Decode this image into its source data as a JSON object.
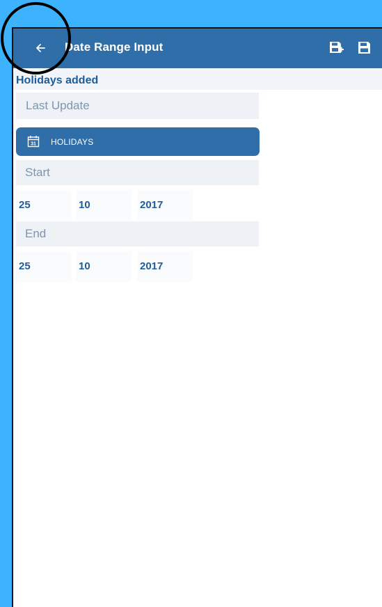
{
  "appbar": {
    "title": "Date Range Input",
    "back_icon": "arrow-left-icon",
    "action_icons": [
      "save-add-icon",
      "save-icon"
    ]
  },
  "status": {
    "text": "Holidays added"
  },
  "last_update": {
    "placeholder": "Last Update",
    "value": ""
  },
  "holidays_button": {
    "label": "HOLIDAYS",
    "icon": "calendar-31-icon"
  },
  "start": {
    "label": "Start",
    "day": "25",
    "month": "10",
    "year": "2017"
  },
  "end": {
    "label": "End",
    "day": "25",
    "month": "10",
    "year": "2017"
  },
  "colors": {
    "background": "#3db3ff",
    "appbar": "#2f6ea8",
    "accent_text": "#1e5d99",
    "field_bg": "#eef2f7",
    "placeholder_text": "#7e95ad"
  }
}
